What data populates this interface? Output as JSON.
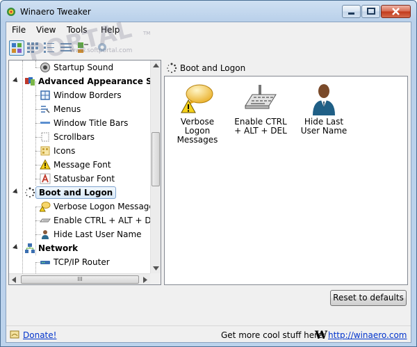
{
  "window": {
    "title": "Winaero Tweaker"
  },
  "menu": [
    "File",
    "View",
    "Tools",
    "Help"
  ],
  "watermark": {
    "main": "PORTAL",
    "tm": "TM",
    "sub": "www.softportal.com"
  },
  "tree": {
    "items": [
      {
        "label": "Startup Sound",
        "level": 2,
        "icon": "speaker-icon"
      },
      {
        "label": "Advanced Appearance Settings",
        "level": 1,
        "icon": "appearance-icon",
        "category": true
      },
      {
        "label": "Window Borders",
        "level": 2,
        "icon": "window-borders-icon"
      },
      {
        "label": "Menus",
        "level": 2,
        "icon": "menus-icon"
      },
      {
        "label": "Window Title Bars",
        "level": 2,
        "icon": "title-bars-icon"
      },
      {
        "label": "Scrollbars",
        "level": 2,
        "icon": "scrollbars-icon"
      },
      {
        "label": "Icons",
        "level": 2,
        "icon": "icons-icon"
      },
      {
        "label": "Message Font",
        "level": 2,
        "icon": "warning-icon"
      },
      {
        "label": "Statusbar Font",
        "level": 2,
        "icon": "font-icon"
      },
      {
        "label": "Boot and Logon",
        "level": 1,
        "icon": "boot-icon",
        "category": true,
        "selected": true
      },
      {
        "label": "Verbose Logon Messages",
        "level": 2,
        "icon": "verbose-icon"
      },
      {
        "label": "Enable CTRL + ALT + DEL",
        "level": 2,
        "icon": "keyboard-icon"
      },
      {
        "label": "Hide Last User Name",
        "level": 2,
        "icon": "user-icon"
      },
      {
        "label": "Network",
        "level": 1,
        "icon": "network-icon",
        "category": true
      },
      {
        "label": "TCP/IP Router",
        "level": 2,
        "icon": "router-icon"
      }
    ],
    "hscroll_grip": "III"
  },
  "section": {
    "title": "Boot and Logon"
  },
  "features": [
    {
      "label": "Verbose Logon Messages",
      "icon": "speech-bubble-warning-icon"
    },
    {
      "label": "Enable CTRL + ALT + DEL",
      "icon": "keyboard-icon"
    },
    {
      "label": "Hide Last User Name",
      "icon": "user-icon"
    }
  ],
  "buttons": {
    "reset": "Reset to defaults"
  },
  "status": {
    "donate": "Donate!",
    "more": "Get more cool stuff here:",
    "site": "http://winaero.com",
    "logo": "W"
  },
  "colors": {
    "link": "#0033cc",
    "selection": "#d9e9f8",
    "accent": "#3c7fb1"
  }
}
